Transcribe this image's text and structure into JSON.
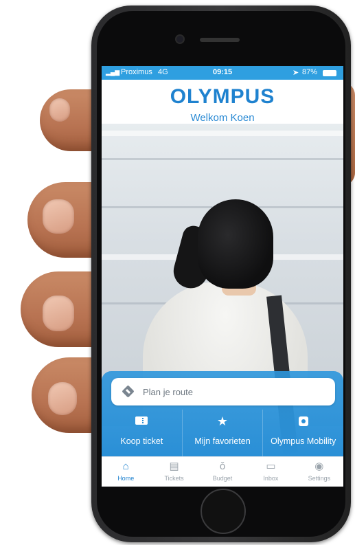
{
  "statusbar": {
    "carrier": "Proximus",
    "network": "4G",
    "time": "09:15",
    "battery": "87%",
    "location_icon": "location-arrow-icon"
  },
  "header": {
    "logo_text": "OLYMPUS",
    "welcome": "Welkom Koen"
  },
  "search": {
    "placeholder": "Plan je route",
    "icon": "directions-diamond-icon"
  },
  "actions": [
    {
      "label": "Koop ticket",
      "icon": "ticket-icon"
    },
    {
      "label": "Mijn favorieten",
      "icon": "star-icon"
    },
    {
      "label": "Olympus Mobility",
      "icon": "mobility-icon"
    }
  ],
  "tabs": [
    {
      "label": "Home",
      "icon": "home-icon",
      "active": true
    },
    {
      "label": "Tickets",
      "icon": "tickets-icon",
      "active": false
    },
    {
      "label": "Budget",
      "icon": "budget-icon",
      "active": false
    },
    {
      "label": "Inbox",
      "icon": "inbox-icon",
      "active": false
    },
    {
      "label": "Settings",
      "icon": "settings-icon",
      "active": false
    }
  ],
  "colors": {
    "brand_blue": "#1f82cf",
    "panel_blue": "#2a8fd6",
    "statusbar_blue": "#2f9fe0"
  }
}
